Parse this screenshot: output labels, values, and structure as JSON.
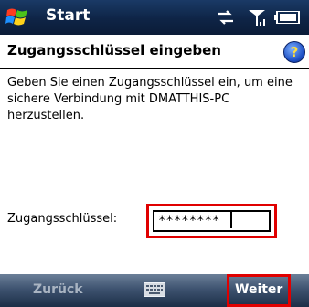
{
  "status_bar": {
    "title": "Start",
    "icons": [
      "windows-logo",
      "connectivity-icon",
      "signal-icon",
      "battery-icon"
    ]
  },
  "header": {
    "title": "Zugangsschlüssel eingeben",
    "help_icon": "?"
  },
  "main": {
    "description": "Geben Sie einen Zugangsschlüssel ein, um eine sichere Verbindung mit DMATTHIS-PC herzustellen.",
    "key_label": "Zugangsschlüssel:",
    "key_value": "********"
  },
  "softkeys": {
    "left_label": "Zurück",
    "center_icon": "keyboard-icon",
    "right_label": "Weiter"
  },
  "colors": {
    "highlight": "#e00000",
    "statusbar": "#0e2446",
    "softkeybar": "#3e5370"
  }
}
